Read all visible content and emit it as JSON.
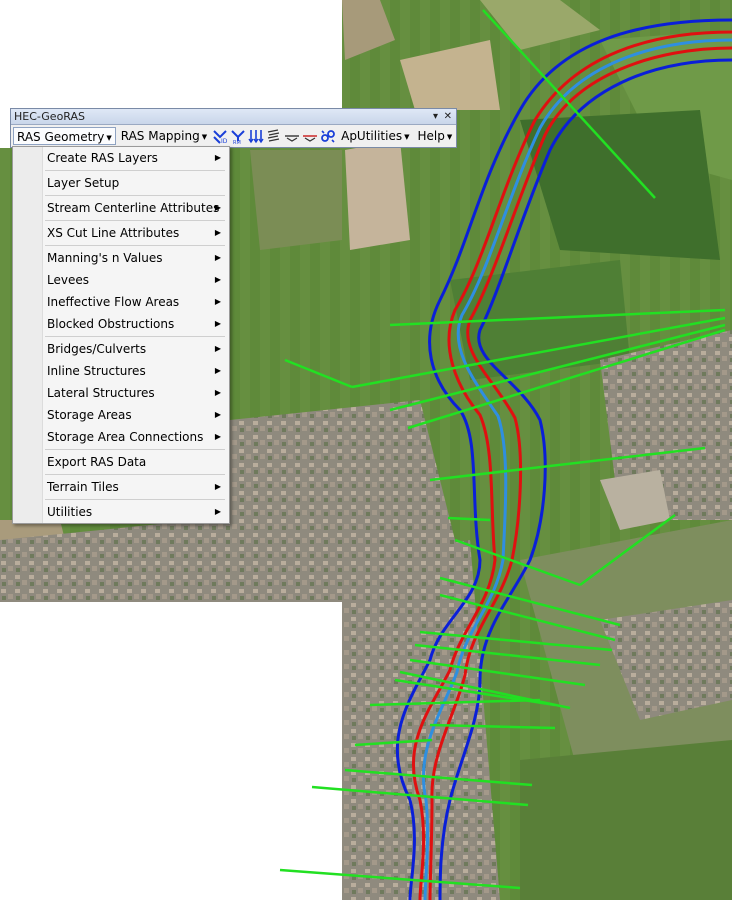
{
  "toolbar": {
    "title": "HEC-GeoRAS",
    "ras_geometry_label": "RAS Geometry",
    "ras_mapping_label": "RAS Mapping",
    "ap_utilities_label": "ApUtilities",
    "help_label": "Help",
    "icons": [
      "assign-river-id-icon",
      "assign-reach-id-icon",
      "flow-direction-icon",
      "stationing-icon",
      "xs-cut-line-icon",
      "bank-station-icon",
      "link-icon"
    ]
  },
  "menu": {
    "items": [
      {
        "label": "Create RAS Layers",
        "submenu": true
      },
      {
        "label": "Layer Setup",
        "submenu": false
      },
      {
        "label": "Stream Centerline Attributes",
        "submenu": true
      },
      {
        "label": "XS Cut Line Attributes",
        "submenu": true
      },
      {
        "label": "Manning's n Values",
        "submenu": true
      },
      {
        "label": "Levees",
        "submenu": true
      },
      {
        "label": "Ineffective Flow Areas",
        "submenu": true
      },
      {
        "label": "Blocked Obstructions",
        "submenu": true
      },
      {
        "label": "Bridges/Culverts",
        "submenu": true
      },
      {
        "label": "Inline Structures",
        "submenu": true
      },
      {
        "label": "Lateral Structures",
        "submenu": true
      },
      {
        "label": "Storage Areas",
        "submenu": true
      },
      {
        "label": "Storage Area Connections",
        "submenu": true
      },
      {
        "label": "Export RAS Data",
        "submenu": false
      },
      {
        "label": "Terrain Tiles",
        "submenu": true
      },
      {
        "label": "Utilities",
        "submenu": true
      }
    ]
  },
  "map": {
    "colors": {
      "centerline": "#2f8fe0",
      "bank_lines": "#e01010",
      "flow_paths": "#0a1fd8",
      "xs_cut_lines": "#22e022",
      "imagery_field": "#5f8a3a",
      "urban": "#9a8f80"
    }
  }
}
